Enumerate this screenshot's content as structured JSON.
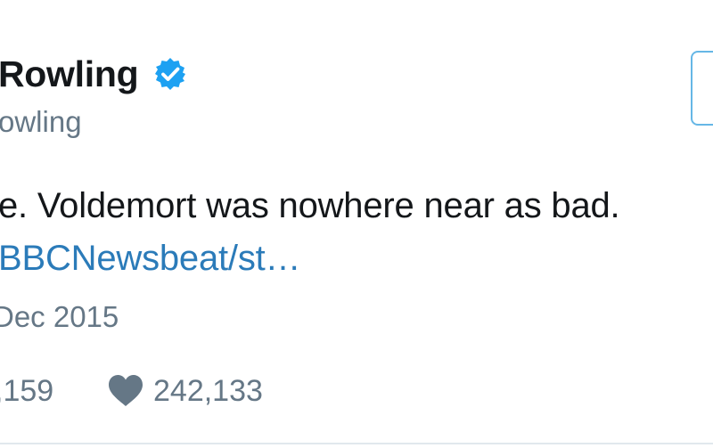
{
  "author": {
    "display_name": "Rowling",
    "handle": "owling",
    "verified": true,
    "verified_icon": "verified-badge-icon"
  },
  "tweet": {
    "text": "e. Voldemort was nowhere near as bad.",
    "link": "BBCNewsbeat/st…",
    "timestamp": "Dec 2015"
  },
  "stats": {
    "retweets": ",159",
    "likes": "242,133",
    "like_icon": "heart-icon"
  },
  "colors": {
    "verified_blue": "#1da1f2",
    "link_blue": "#2b7bb9",
    "secondary_gray": "#657786",
    "text_dark": "#14171a",
    "follow_border": "#66b7e6"
  }
}
